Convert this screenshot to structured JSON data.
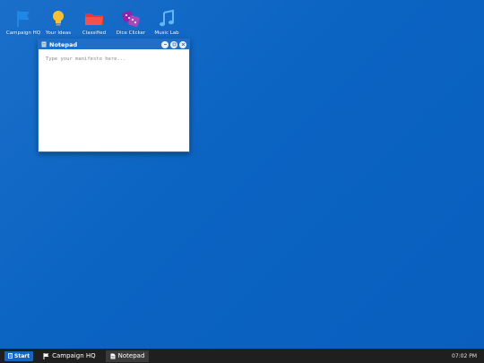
{
  "desktop": {
    "icons": [
      {
        "label": "Campaign HQ",
        "icon": "flag-icon",
        "color": "#1e88e5"
      },
      {
        "label": "Your Ideas",
        "icon": "lightbulb-icon",
        "color": "#fbc02d"
      },
      {
        "label": "Classified",
        "icon": "folder-icon",
        "color": "#e53935"
      },
      {
        "label": "Dice Clicker",
        "icon": "dice-icon",
        "color": "#8e24aa"
      },
      {
        "label": "Music Lab",
        "icon": "music-note-icon",
        "color": "#42a5f5"
      }
    ]
  },
  "notepad": {
    "title": "Notepad",
    "placeholder": "Type your manifesto here..."
  },
  "taskbar": {
    "start_label": "Start",
    "tasks": [
      {
        "label": "Campaign HQ",
        "icon": "flag-icon"
      },
      {
        "label": "Notepad",
        "icon": "document-icon",
        "active": true
      }
    ],
    "clock": "07:02 PM"
  }
}
